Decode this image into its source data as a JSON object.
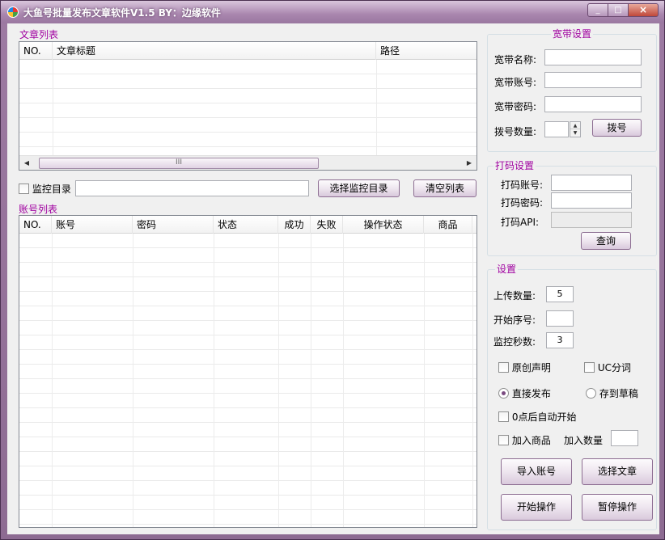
{
  "window": {
    "title": "大鱼号批量发布文章软件V1.5   BY：边缘软件",
    "min": "_",
    "max": "□",
    "close": "×"
  },
  "articles": {
    "group_title": "文章列表",
    "columns": [
      "NO.",
      "文章标题",
      "路径"
    ],
    "scroll_left": "◀",
    "scroll_right": "▶",
    "scroll_thumb": "III"
  },
  "monitor": {
    "checkbox_label": "监控目录",
    "path_value": "",
    "select_button": "选择监控目录",
    "clear_button": "清空列表"
  },
  "accounts": {
    "group_title": "账号列表",
    "columns": [
      "NO.",
      "账号",
      "密码",
      "状态",
      "成功",
      "失败",
      "操作状态",
      "商品"
    ]
  },
  "broadband": {
    "group_title": "宽带设置",
    "name_label": "宽带名称:",
    "name_value": "",
    "account_label": "宽带账号:",
    "account_value": "",
    "password_label": "宽带密码:",
    "password_value": "",
    "dial_count_label": "拨号数量:",
    "dial_count_value": "",
    "dial_button": "拨号",
    "spin_up": "▲",
    "spin_down": "▼"
  },
  "captcha": {
    "group_title": "打码设置",
    "account_label": "打码账号:",
    "account_value": "",
    "password_label": "打码密码:",
    "password_value": "",
    "api_label": "打码API:",
    "api_value": "",
    "query_button": "查询"
  },
  "settings": {
    "group_title": "设置",
    "upload_label": "上传数量:",
    "upload_value": "5",
    "start_label": "开始序号:",
    "start_value": "",
    "monitor_label": "监控秒数:",
    "monitor_value": "3",
    "original_label": "原创声明",
    "uc_label": "UC分词",
    "publish_label": "直接发布",
    "draft_label": "存到草稿",
    "auto_start_label": "0点后自动开始",
    "add_goods_label": "加入商品",
    "add_count_label": "加入数量",
    "add_count_value": "",
    "import_button": "导入账号",
    "select_article_button": "选择文章",
    "start_button": "开始操作",
    "pause_button": "暂停操作"
  }
}
